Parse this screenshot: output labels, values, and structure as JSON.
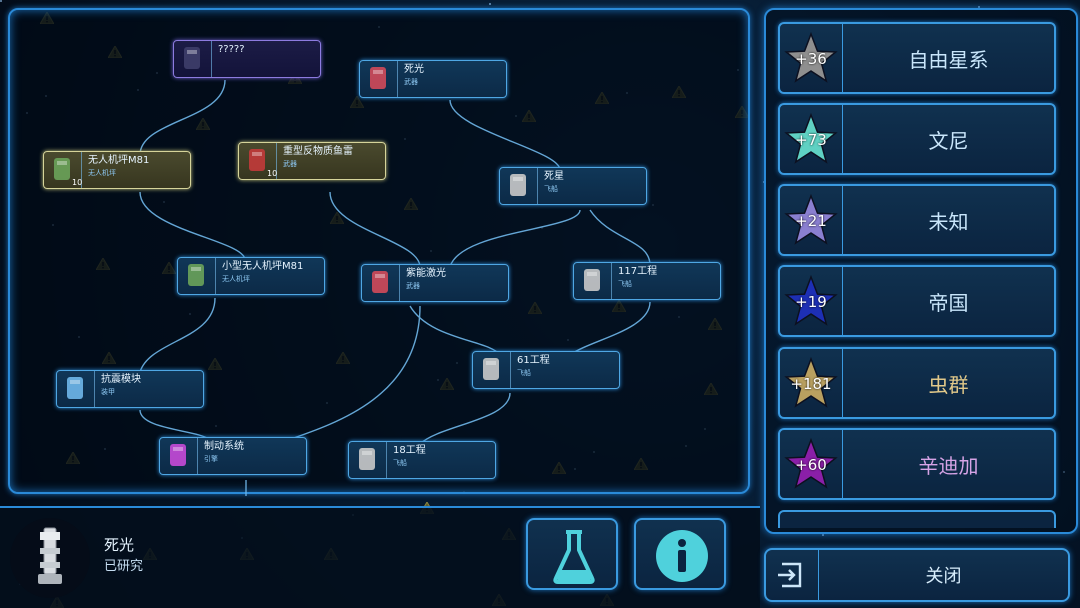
{
  "tech_tree": {
    "nodes": [
      {
        "id": "unknown",
        "title": "?????",
        "subtitle": "",
        "count": ""
      },
      {
        "id": "death-ray",
        "title": "死光",
        "subtitle": "武器",
        "count": ""
      },
      {
        "id": "drone-bay-m81",
        "title": "无人机坪M81",
        "subtitle": "无人机坪",
        "count": "10"
      },
      {
        "id": "antimatter-torpedo",
        "title": "重型反物质鱼雷",
        "subtitle": "武器",
        "count": "10"
      },
      {
        "id": "death-star",
        "title": "死星",
        "subtitle": "飞船",
        "count": ""
      },
      {
        "id": "small-drone-bay",
        "title": "小型无人机坪M81",
        "subtitle": "无人机坪",
        "count": ""
      },
      {
        "id": "purple-laser",
        "title": "紫能激光",
        "subtitle": "武器",
        "count": ""
      },
      {
        "id": "project-117",
        "title": "117工程",
        "subtitle": "飞船",
        "count": ""
      },
      {
        "id": "project-61",
        "title": "61工程",
        "subtitle": "飞船",
        "count": ""
      },
      {
        "id": "shock-module",
        "title": "抗震模块",
        "subtitle": "装甲",
        "count": ""
      },
      {
        "id": "brake-system",
        "title": "制动系统",
        "subtitle": "引擎",
        "count": ""
      },
      {
        "id": "project-18",
        "title": "18工程",
        "subtitle": "飞船",
        "count": ""
      }
    ]
  },
  "factions": [
    {
      "score": "+36",
      "name": "自由星系",
      "star_color": "#8f8f8f",
      "name_color": "#c9e6fb"
    },
    {
      "score": "+73",
      "name": "文尼",
      "star_color": "#5fd1c3",
      "name_color": "#c9e6fb"
    },
    {
      "score": "+21",
      "name": "未知",
      "star_color": "#8a7fd0",
      "name_color": "#c9e6fb"
    },
    {
      "score": "+19",
      "name": "帝国",
      "star_color": "#1d2fb5",
      "name_color": "#c9e6fb"
    },
    {
      "score": "+181",
      "name": "虫群",
      "star_color": "#b9a060",
      "name_color": "#e2c98a"
    },
    {
      "score": "+60",
      "name": "辛迪加",
      "star_color": "#8b1fa8",
      "name_color": "#d6a3e6"
    }
  ],
  "selection": {
    "title": "死光",
    "status": "已研究"
  },
  "buttons": {
    "research_icon": "flask-icon",
    "info_icon": "info-icon",
    "close_label": "关闭",
    "close_icon": "exit-icon"
  },
  "colors": {
    "accent": "#2a8ad8",
    "panel": "#0b2440",
    "gold_node": "#d6d49a",
    "purple_node": "#8d7be0"
  }
}
